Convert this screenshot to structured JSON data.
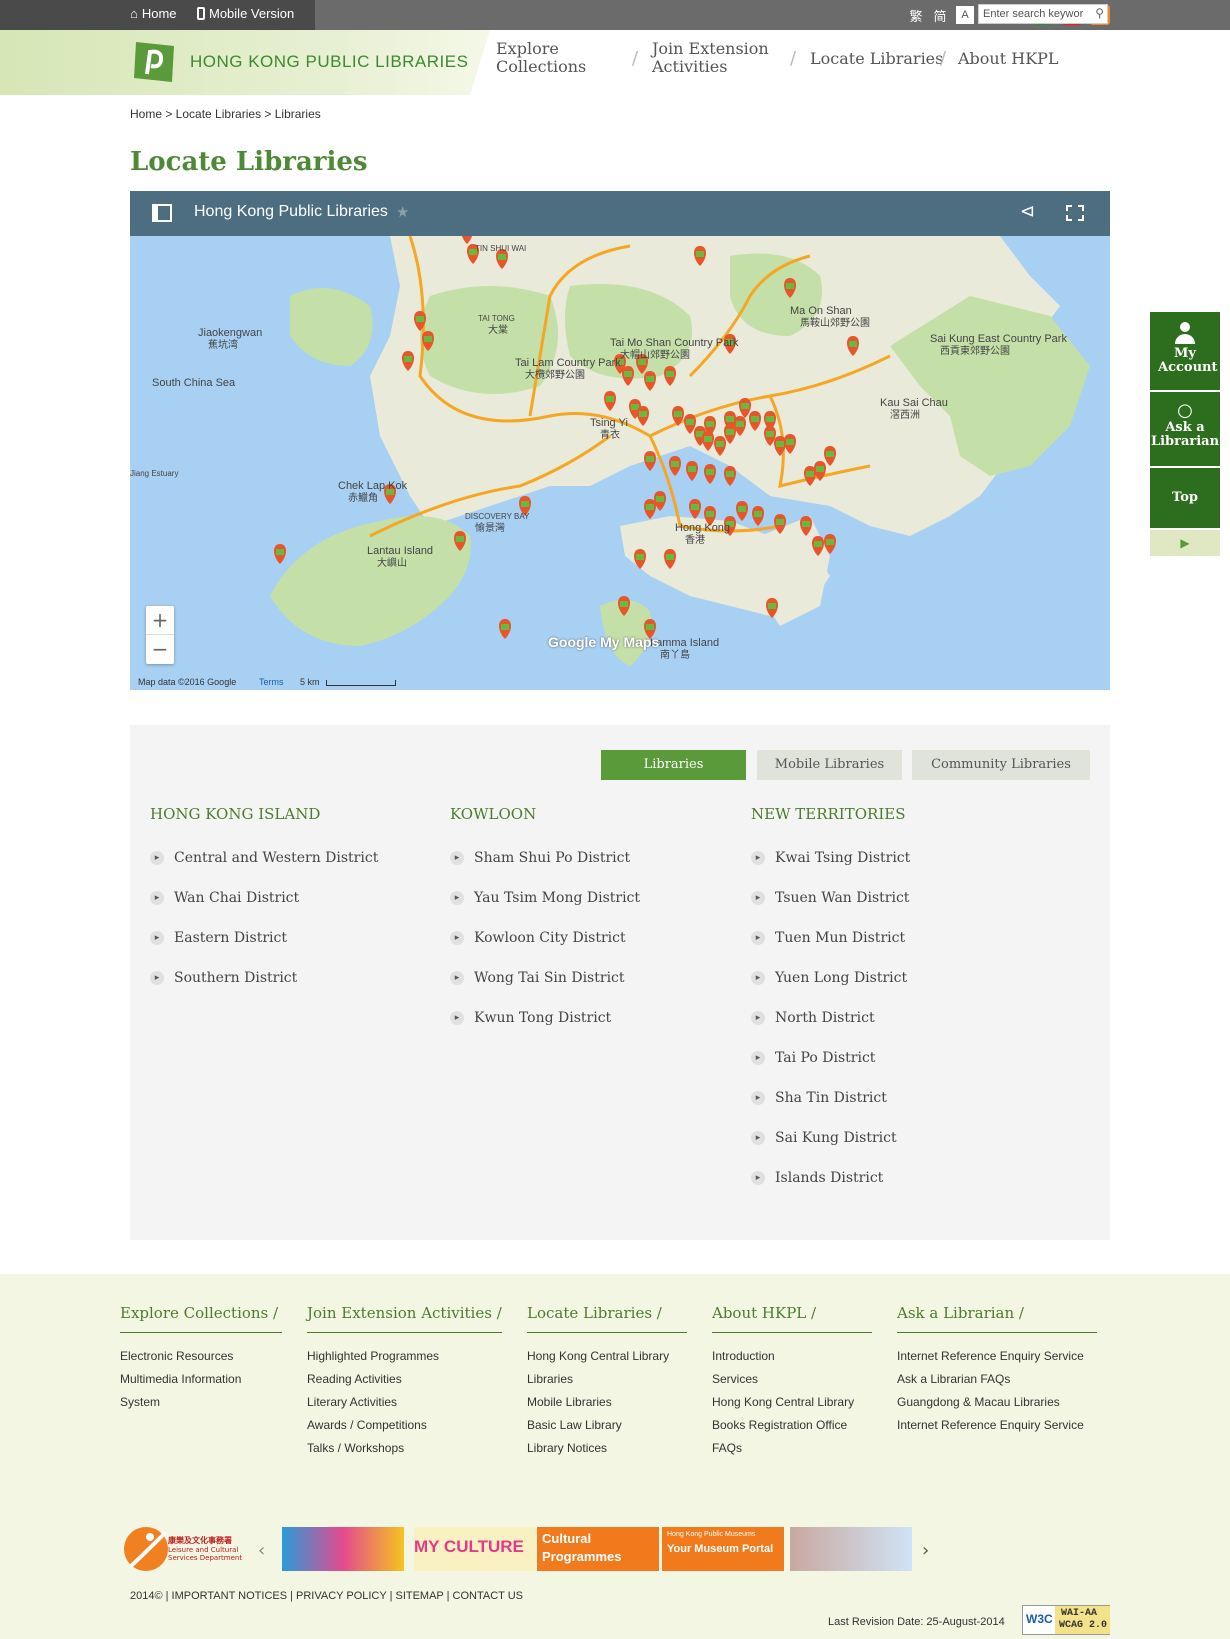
{
  "topbar": {
    "home": "Home",
    "mobile": "Mobile Version",
    "lang_trad": "繁",
    "lang_simp": "简",
    "font_small": "A",
    "font_medium": "A",
    "font_large": "A",
    "search_placeholder": "Enter search keywor"
  },
  "header": {
    "logo_text": "HONG KONG PUBLIC LIBRARIES",
    "nav": [
      {
        "line1": "Explore",
        "line2": "Collections"
      },
      {
        "line1": "Join Extension",
        "line2": "Activities"
      },
      {
        "line1": "Locate Libraries",
        "line2": ""
      },
      {
        "line1": "About HKPL",
        "line2": ""
      }
    ]
  },
  "breadcrumb": "Home > Locate Libraries >   Libraries",
  "page_title": "Locate Libraries",
  "map": {
    "title": "Hong Kong Public Libraries",
    "footer_data": "Map data ©2016 Google",
    "footer_terms": "Terms",
    "footer_scale": "5 km",
    "watermark": "Google My Maps",
    "zoom_in": "+",
    "zoom_out": "−",
    "labels": [
      {
        "text": "Jiaokengwan",
        "sub": "蕉坑湾"
      },
      {
        "text": "Chek Lap Kok",
        "sub": "赤鱲角"
      },
      {
        "text": "Lantau Island",
        "sub": "大嶼山"
      },
      {
        "text": "Tai Lam Country Park",
        "sub": "大欖郊野公園"
      },
      {
        "text": "Tai Mo Shan Country Park",
        "sub": "大帽山郊野公園"
      },
      {
        "text": "Tsing Yi",
        "sub": "青衣"
      },
      {
        "text": "Hong Kong",
        "sub": "香港"
      },
      {
        "text": "Sai Kung East Country Park",
        "sub": "西貢東郊野公園"
      },
      {
        "text": "Kau Sai Chau",
        "sub": "滘西洲"
      },
      {
        "text": "Ma On Shan",
        "sub": "馬鞍山郊野公園"
      },
      {
        "text": "Lamma Island",
        "sub": "南丫島"
      },
      {
        "text": "South China Sea",
        "sub": ""
      },
      {
        "text": "TAI TONG",
        "sub": "大棠"
      },
      {
        "text": "DISCOVERY BAY",
        "sub": "愉景灣"
      },
      {
        "text": "TIN SHUI WAI",
        "sub": ""
      },
      {
        "text": "Jiang Estuary",
        "sub": ""
      }
    ]
  },
  "panel": {
    "tabs": [
      "Libraries",
      "Mobile Libraries",
      "Community Libraries"
    ],
    "columns": [
      {
        "heading": "HONG KONG ISLAND",
        "items": [
          "Central and Western District",
          "Wan Chai District",
          "Eastern District",
          "Southern District"
        ]
      },
      {
        "heading": "KOWLOON",
        "items": [
          "Sham Shui Po District",
          "Yau Tsim Mong District",
          "Kowloon City District",
          "Wong Tai Sin District",
          "Kwun Tong District"
        ]
      },
      {
        "heading": "NEW TERRITORIES",
        "items": [
          "Kwai Tsing District",
          "Tsuen Wan District",
          "Tuen Mun District",
          "Yuen Long District",
          "North District",
          "Tai Po District",
          "Sha Tin District",
          "Sai Kung District",
          "Islands District"
        ]
      }
    ]
  },
  "side": {
    "account": "My Account",
    "ask1": "Ask a",
    "ask2": "Librarian",
    "top": "Top"
  },
  "footer": {
    "columns": [
      {
        "heading": "Explore Collections /",
        "links": [
          "Electronic Resources",
          "Multimedia Information",
          "System"
        ]
      },
      {
        "heading": "Join Extension Activities /",
        "links": [
          "Highlighted Programmes",
          "Reading Activities",
          "Literary Activities",
          "Awards / Competitions",
          "Talks / Workshops"
        ]
      },
      {
        "heading": "Locate Libraries /",
        "links": [
          "Hong Kong Central Library",
          "Libraries",
          "Mobile Libraries",
          "Basic Law Library",
          "Library Notices"
        ]
      },
      {
        "heading": "About HKPL /",
        "links": [
          "Introduction",
          "Services",
          "Hong Kong Central Library",
          "Books Registration Office",
          "FAQs"
        ]
      },
      {
        "heading": "Ask a Librarian /",
        "links": [
          "Internet Reference Enquiry Service",
          "Ask a Librarian FAQs",
          "Guangdong & Macau Libraries",
          "Internet Reference Enquiry Service"
        ]
      }
    ],
    "lcsd_cn": "康樂及文化事務署",
    "lcsd_en1": "Leisure and Cultural",
    "lcsd_en2": "Services Department",
    "banners": [
      "MY CULTURE",
      "Cultural",
      "Programmes",
      "Your Museum Portal",
      "Hong Kong Public Museums"
    ],
    "bottom_links": "2014©   |   IMPORTANT NOTICES   |   PRIVACY POLICY   |   SITEMAP   |   CONTACT US",
    "revision": "Last Revision Date: 25-August-2014",
    "w3c": "W3C",
    "wai1": "WAI-AA",
    "wai2": "WCAG 2.0"
  },
  "colors": {
    "green": "#4e8a36",
    "dark_green": "#2d6e1e",
    "map_bar": "#4d6e80",
    "water": "#a8d0f3",
    "land": "#e9ead9",
    "park": "#c4dfa8",
    "road": "#f5a623"
  }
}
